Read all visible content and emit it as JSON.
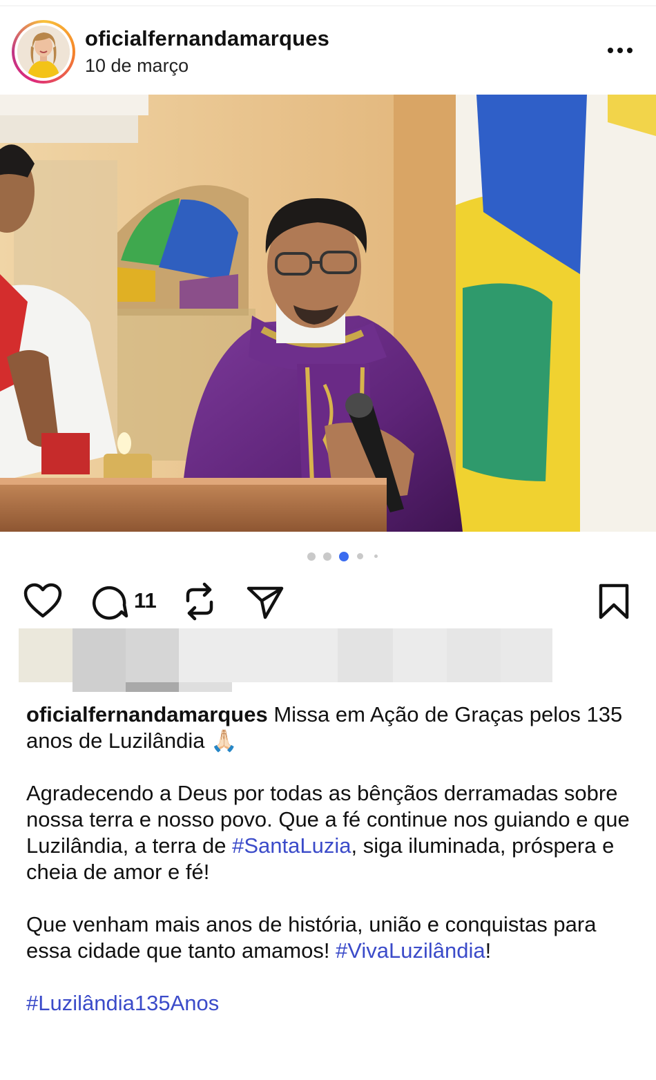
{
  "post": {
    "username": "oficialfernandamarques",
    "date": "10 de março"
  },
  "carousel": {
    "total_slides": 5,
    "active_slide": 3
  },
  "actions": {
    "comment_count": "11",
    "icons": [
      "heart-icon",
      "comment-icon",
      "repost-icon",
      "share-icon",
      "bookmark-icon"
    ]
  },
  "caption": {
    "username": "oficialfernandamarques",
    "line1_text": " Missa em Ação de Graças pelos 135 anos de Luzilândia ",
    "emoji": "🙏🏻",
    "para2_text": "Agradecendo a Deus por todas as bênçãos derramadas sobre nossa terra e nosso povo. Que a fé continue nos guiando e que Luzilândia, a terra de ",
    "hashtag1": "#SantaLuzia",
    "para2_tail": ", siga iluminada, próspera e cheia de amor e fé!",
    "para3_text": "Que venham mais anos de história, união e conquistas para essa cidade que tanto amamos! ",
    "hashtag2": "#VivaLuzilândia",
    "para3_tail": "!",
    "hashtag3": "#Luzilândia135Anos"
  },
  "colors": {
    "hashtag": "#3b4bc9",
    "carousel_active": "#3b6cf0",
    "carousel_inactive": "#c9c9c9",
    "vestment": "#6a2a86",
    "background_wall": "#e8c48e"
  }
}
